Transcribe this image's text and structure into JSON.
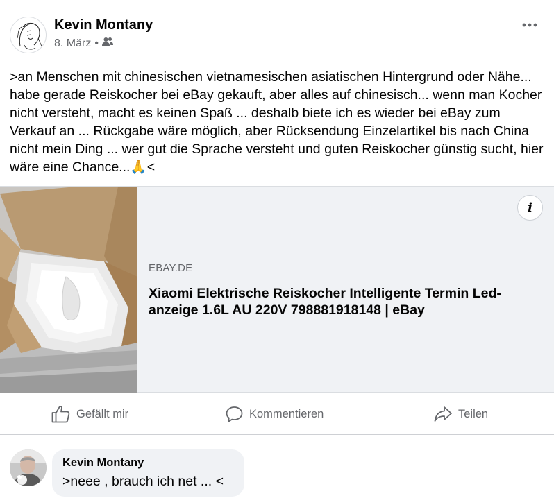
{
  "post": {
    "author": "Kevin Montany",
    "date": "8. März",
    "separator": "•",
    "audience_icon": "friends-icon",
    "more_icon": "more-options-icon",
    "text": ">an Menschen mit chinesischen vietnamesischen asiatischen Hintergrund oder Nähe... habe gerade Reiskocher bei eBay gekauft, aber alles auf chinesisch... wenn man Kocher nicht versteht, macht es keinen Spaß ... deshalb biete ich es wieder bei eBay zum Verkauf an ... Rückgabe wäre möglich, aber Rücksendung Einzelartikel bis nach China nicht mein Ding ... wer gut die Sprache versteht und guten Reiskocher günstig sucht, hier wäre eine Chance...🙏<"
  },
  "link_preview": {
    "domain": "EBAY.DE",
    "title": "Xiaomi Elektrische Reiskocher Intelligente Termin Led-anzeige 1.6L AU 220V 798881918148 | eBay",
    "info_label": "i",
    "image_icon": "product-box-image"
  },
  "actions": {
    "like_label": "Gefällt mir",
    "comment_label": "Kommentieren",
    "share_label": "Teilen"
  },
  "comment": {
    "author": "Kevin Montany",
    "text": ">neee , brauch ich net ... <"
  },
  "colors": {
    "text_primary": "#050505",
    "text_secondary": "#65676b",
    "bubble_background": "#f0f2f5",
    "divider": "#ced0d4"
  }
}
